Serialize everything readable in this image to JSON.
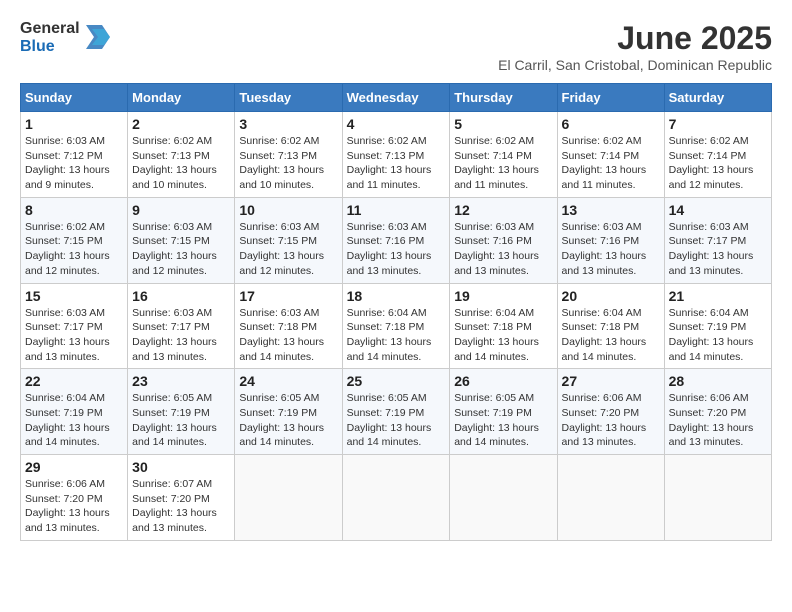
{
  "logo": {
    "general": "General",
    "blue": "Blue"
  },
  "title": "June 2025",
  "location": "El Carril, San Cristobal, Dominican Republic",
  "days_of_week": [
    "Sunday",
    "Monday",
    "Tuesday",
    "Wednesday",
    "Thursday",
    "Friday",
    "Saturday"
  ],
  "weeks": [
    [
      {
        "day": "1",
        "sunrise": "6:03 AM",
        "sunset": "7:12 PM",
        "daylight": "13 hours and 9 minutes."
      },
      {
        "day": "2",
        "sunrise": "6:02 AM",
        "sunset": "7:13 PM",
        "daylight": "13 hours and 10 minutes."
      },
      {
        "day": "3",
        "sunrise": "6:02 AM",
        "sunset": "7:13 PM",
        "daylight": "13 hours and 10 minutes."
      },
      {
        "day": "4",
        "sunrise": "6:02 AM",
        "sunset": "7:13 PM",
        "daylight": "13 hours and 11 minutes."
      },
      {
        "day": "5",
        "sunrise": "6:02 AM",
        "sunset": "7:14 PM",
        "daylight": "13 hours and 11 minutes."
      },
      {
        "day": "6",
        "sunrise": "6:02 AM",
        "sunset": "7:14 PM",
        "daylight": "13 hours and 11 minutes."
      },
      {
        "day": "7",
        "sunrise": "6:02 AM",
        "sunset": "7:14 PM",
        "daylight": "13 hours and 12 minutes."
      }
    ],
    [
      {
        "day": "8",
        "sunrise": "6:02 AM",
        "sunset": "7:15 PM",
        "daylight": "13 hours and 12 minutes."
      },
      {
        "day": "9",
        "sunrise": "6:03 AM",
        "sunset": "7:15 PM",
        "daylight": "13 hours and 12 minutes."
      },
      {
        "day": "10",
        "sunrise": "6:03 AM",
        "sunset": "7:15 PM",
        "daylight": "13 hours and 12 minutes."
      },
      {
        "day": "11",
        "sunrise": "6:03 AM",
        "sunset": "7:16 PM",
        "daylight": "13 hours and 13 minutes."
      },
      {
        "day": "12",
        "sunrise": "6:03 AM",
        "sunset": "7:16 PM",
        "daylight": "13 hours and 13 minutes."
      },
      {
        "day": "13",
        "sunrise": "6:03 AM",
        "sunset": "7:16 PM",
        "daylight": "13 hours and 13 minutes."
      },
      {
        "day": "14",
        "sunrise": "6:03 AM",
        "sunset": "7:17 PM",
        "daylight": "13 hours and 13 minutes."
      }
    ],
    [
      {
        "day": "15",
        "sunrise": "6:03 AM",
        "sunset": "7:17 PM",
        "daylight": "13 hours and 13 minutes."
      },
      {
        "day": "16",
        "sunrise": "6:03 AM",
        "sunset": "7:17 PM",
        "daylight": "13 hours and 13 minutes."
      },
      {
        "day": "17",
        "sunrise": "6:03 AM",
        "sunset": "7:18 PM",
        "daylight": "13 hours and 14 minutes."
      },
      {
        "day": "18",
        "sunrise": "6:04 AM",
        "sunset": "7:18 PM",
        "daylight": "13 hours and 14 minutes."
      },
      {
        "day": "19",
        "sunrise": "6:04 AM",
        "sunset": "7:18 PM",
        "daylight": "13 hours and 14 minutes."
      },
      {
        "day": "20",
        "sunrise": "6:04 AM",
        "sunset": "7:18 PM",
        "daylight": "13 hours and 14 minutes."
      },
      {
        "day": "21",
        "sunrise": "6:04 AM",
        "sunset": "7:19 PM",
        "daylight": "13 hours and 14 minutes."
      }
    ],
    [
      {
        "day": "22",
        "sunrise": "6:04 AM",
        "sunset": "7:19 PM",
        "daylight": "13 hours and 14 minutes."
      },
      {
        "day": "23",
        "sunrise": "6:05 AM",
        "sunset": "7:19 PM",
        "daylight": "13 hours and 14 minutes."
      },
      {
        "day": "24",
        "sunrise": "6:05 AM",
        "sunset": "7:19 PM",
        "daylight": "13 hours and 14 minutes."
      },
      {
        "day": "25",
        "sunrise": "6:05 AM",
        "sunset": "7:19 PM",
        "daylight": "13 hours and 14 minutes."
      },
      {
        "day": "26",
        "sunrise": "6:05 AM",
        "sunset": "7:19 PM",
        "daylight": "13 hours and 14 minutes."
      },
      {
        "day": "27",
        "sunrise": "6:06 AM",
        "sunset": "7:20 PM",
        "daylight": "13 hours and 13 minutes."
      },
      {
        "day": "28",
        "sunrise": "6:06 AM",
        "sunset": "7:20 PM",
        "daylight": "13 hours and 13 minutes."
      }
    ],
    [
      {
        "day": "29",
        "sunrise": "6:06 AM",
        "sunset": "7:20 PM",
        "daylight": "13 hours and 13 minutes."
      },
      {
        "day": "30",
        "sunrise": "6:07 AM",
        "sunset": "7:20 PM",
        "daylight": "13 hours and 13 minutes."
      },
      null,
      null,
      null,
      null,
      null
    ]
  ]
}
